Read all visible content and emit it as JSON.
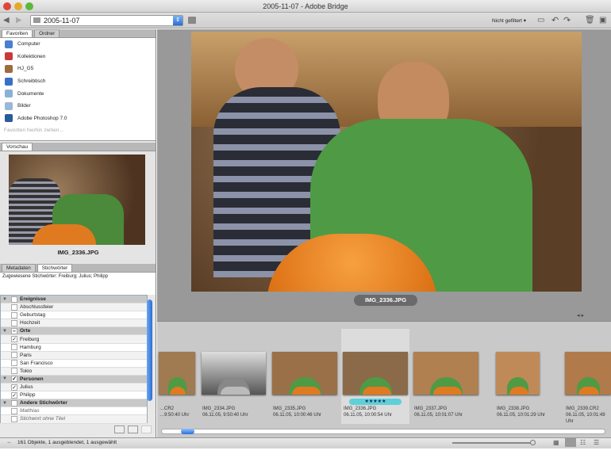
{
  "window": {
    "title": "2005-11-07 - Adobe Bridge"
  },
  "toolbar": {
    "path": "2005-11-07",
    "filter": "Nicht gefiltert ▾"
  },
  "left": {
    "tabs": [
      "Favoriten",
      "Ordner"
    ],
    "favorites": [
      {
        "label": "Computer",
        "color": "#4a7fd0"
      },
      {
        "label": "Kollektionen",
        "color": "#c83a3a"
      },
      {
        "label": "HJ_G5",
        "color": "#a06a40"
      },
      {
        "label": "Schreibtisch",
        "color": "#3a6fc8"
      },
      {
        "label": "Dokumente",
        "color": "#8ab0d8"
      },
      {
        "label": "Bilder",
        "color": "#9ab8d8"
      },
      {
        "label": "Adobe Photoshop 7.0",
        "color": "#2a5a9a"
      }
    ],
    "favorites_hint": "Favoriten hierhin ziehen...",
    "preview_tab": "Vorschau",
    "preview_filename": "IMG_2336.JPG",
    "meta_tabs": [
      "Metadaten",
      "Stichwörter"
    ],
    "assigned": "Zugewiesene Stichwörter: Freiburg; Julius; Philipp",
    "keywords": [
      {
        "label": "Ereignisse",
        "group": true,
        "check": ""
      },
      {
        "label": "Abschlussfeier",
        "check": ""
      },
      {
        "label": "Geburtstag",
        "check": ""
      },
      {
        "label": "Hochzeit",
        "check": ""
      },
      {
        "label": "Orte",
        "group": true,
        "check": "–"
      },
      {
        "label": "Freiburg",
        "check": "✓"
      },
      {
        "label": "Hamburg",
        "check": ""
      },
      {
        "label": "Paris",
        "check": ""
      },
      {
        "label": "San Francisco",
        "check": ""
      },
      {
        "label": "Tokio",
        "check": ""
      },
      {
        "label": "Personen",
        "group": true,
        "check": "✓"
      },
      {
        "label": "Julius",
        "check": "✓"
      },
      {
        "label": "Philipp",
        "check": "✓"
      },
      {
        "label": "Andere Stichwörter",
        "group": true,
        "check": ""
      },
      {
        "label": "Matthias",
        "check": ""
      },
      {
        "label": "Stichwort ohne Titel",
        "check": ""
      }
    ]
  },
  "main": {
    "filename": "IMG_2336.JPG"
  },
  "filmstrip": [
    {
      "name": "…CR2",
      "date": "…9:50:40 Uhr"
    },
    {
      "name": "IMG_2334.JPG",
      "date": "06.11.05, 9:50:40 Uhr"
    },
    {
      "name": "IMG_2335.JPG",
      "date": "06.11.05, 10:00:46 Uhr"
    },
    {
      "name": "IMG_2336.JPG",
      "date": "06.11.05, 10:00:54 Uhr",
      "rating": "★★★★★"
    },
    {
      "name": "IMG_2337.JPG",
      "date": "06.11.05, 10:01:07 Uhr"
    },
    {
      "name": "IMG_2338.JPG",
      "date": "06.11.05, 10:01:29 Uhr"
    },
    {
      "name": "IMG_2339.CR2",
      "date": "06.11.05, 10:01:49 Uhr"
    }
  ],
  "status": "161 Objekte, 1 ausgeblendet, 1 ausgewählt"
}
